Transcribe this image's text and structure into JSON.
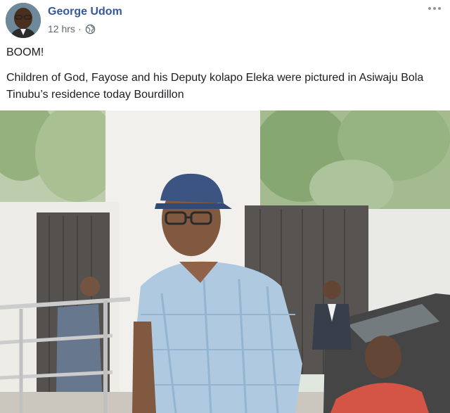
{
  "post": {
    "author": "George Udom",
    "time": "12 hrs",
    "separator": "·",
    "lines": [
      "BOOM!",
      "Children of God, Fayose and his Deputy kolapo Eleka were pictured in Asiwaju Bola Tinubu’s residence today Bourdillon"
    ],
    "privacy_icon": "globe-icon",
    "menu_icon": "more-options-icon"
  },
  "colors": {
    "author_link": "#365899",
    "meta_text": "#616770",
    "body_text": "#1c1e21"
  }
}
